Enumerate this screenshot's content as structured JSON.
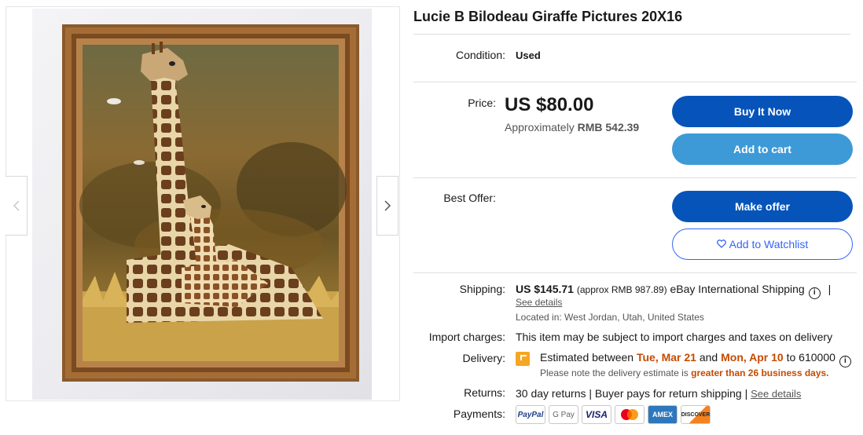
{
  "listing": {
    "title": "Lucie B Bilodeau Giraffe Pictures 20X16"
  },
  "condition": {
    "label": "Condition:",
    "value": "Used"
  },
  "price": {
    "label": "Price:",
    "value": "US $80.00",
    "approx_prefix": "Approximately ",
    "approx_value": "RMB 542.39"
  },
  "buttons": {
    "buy_now": "Buy It Now",
    "add_to_cart": "Add to cart",
    "make_offer": "Make offer",
    "watchlist": "Add to Watchlist"
  },
  "best_offer": {
    "label": "Best Offer:"
  },
  "shipping": {
    "label": "Shipping:",
    "amount": "US $145.71",
    "approx": "(approx RMB 987.89)",
    "method": "eBay International Shipping",
    "separator": "|",
    "see_details": "See details",
    "location": "Located in: West Jordan, Utah, United States"
  },
  "import_charges": {
    "label": "Import charges:",
    "value": "This item may be subject to import charges and taxes on delivery"
  },
  "delivery": {
    "label": "Delivery:",
    "prefix": "Estimated between ",
    "start": "Tue, Mar 21",
    "middle": " and ",
    "end": "Mon, Apr 10",
    "suffix": " to 610000",
    "note_prefix": "Please note the delivery estimate is ",
    "note_emph": "greater than 26 business days."
  },
  "returns": {
    "label": "Returns:",
    "value": "30 day returns | Buyer pays for return shipping | ",
    "see_details": "See details"
  },
  "payments": {
    "label": "Payments:",
    "methods": [
      "PayPal",
      "G Pay",
      "VISA",
      "Mastercard",
      "AMEX",
      "DISCOVER"
    ]
  },
  "icons": {
    "prev": "chevron-left-icon",
    "next": "chevron-right-icon",
    "info": "info-icon",
    "heart": "heart-icon",
    "delivery": "delivery-flag-icon"
  },
  "colors": {
    "primary": "#0654ba",
    "secondary": "#3d9ad7",
    "link": "#3665f3",
    "emphasis": "#c54b00"
  }
}
